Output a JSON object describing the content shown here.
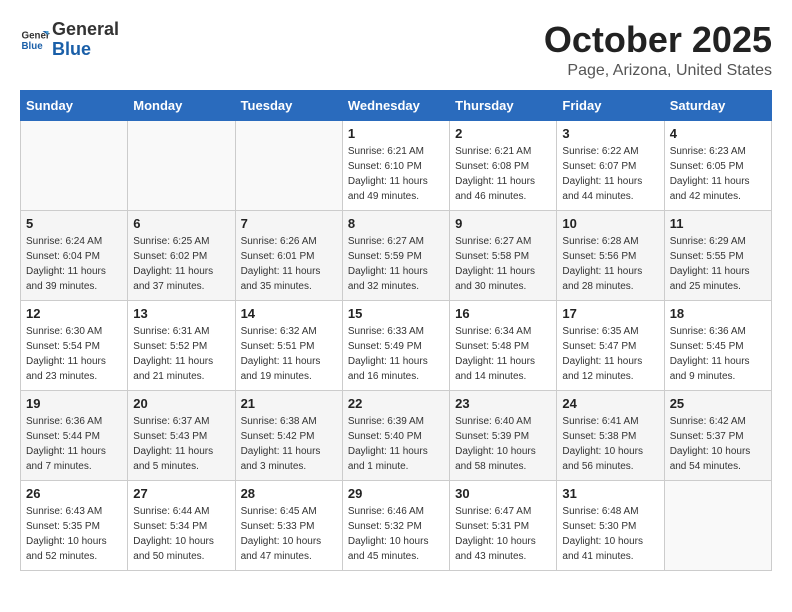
{
  "header": {
    "logo_line1": "General",
    "logo_line2": "Blue",
    "month": "October 2025",
    "location": "Page, Arizona, United States"
  },
  "days_of_week": [
    "Sunday",
    "Monday",
    "Tuesday",
    "Wednesday",
    "Thursday",
    "Friday",
    "Saturday"
  ],
  "weeks": [
    [
      {
        "day": "",
        "content": ""
      },
      {
        "day": "",
        "content": ""
      },
      {
        "day": "",
        "content": ""
      },
      {
        "day": "1",
        "content": "Sunrise: 6:21 AM\nSunset: 6:10 PM\nDaylight: 11 hours\nand 49 minutes."
      },
      {
        "day": "2",
        "content": "Sunrise: 6:21 AM\nSunset: 6:08 PM\nDaylight: 11 hours\nand 46 minutes."
      },
      {
        "day": "3",
        "content": "Sunrise: 6:22 AM\nSunset: 6:07 PM\nDaylight: 11 hours\nand 44 minutes."
      },
      {
        "day": "4",
        "content": "Sunrise: 6:23 AM\nSunset: 6:05 PM\nDaylight: 11 hours\nand 42 minutes."
      }
    ],
    [
      {
        "day": "5",
        "content": "Sunrise: 6:24 AM\nSunset: 6:04 PM\nDaylight: 11 hours\nand 39 minutes."
      },
      {
        "day": "6",
        "content": "Sunrise: 6:25 AM\nSunset: 6:02 PM\nDaylight: 11 hours\nand 37 minutes."
      },
      {
        "day": "7",
        "content": "Sunrise: 6:26 AM\nSunset: 6:01 PM\nDaylight: 11 hours\nand 35 minutes."
      },
      {
        "day": "8",
        "content": "Sunrise: 6:27 AM\nSunset: 5:59 PM\nDaylight: 11 hours\nand 32 minutes."
      },
      {
        "day": "9",
        "content": "Sunrise: 6:27 AM\nSunset: 5:58 PM\nDaylight: 11 hours\nand 30 minutes."
      },
      {
        "day": "10",
        "content": "Sunrise: 6:28 AM\nSunset: 5:56 PM\nDaylight: 11 hours\nand 28 minutes."
      },
      {
        "day": "11",
        "content": "Sunrise: 6:29 AM\nSunset: 5:55 PM\nDaylight: 11 hours\nand 25 minutes."
      }
    ],
    [
      {
        "day": "12",
        "content": "Sunrise: 6:30 AM\nSunset: 5:54 PM\nDaylight: 11 hours\nand 23 minutes."
      },
      {
        "day": "13",
        "content": "Sunrise: 6:31 AM\nSunset: 5:52 PM\nDaylight: 11 hours\nand 21 minutes."
      },
      {
        "day": "14",
        "content": "Sunrise: 6:32 AM\nSunset: 5:51 PM\nDaylight: 11 hours\nand 19 minutes."
      },
      {
        "day": "15",
        "content": "Sunrise: 6:33 AM\nSunset: 5:49 PM\nDaylight: 11 hours\nand 16 minutes."
      },
      {
        "day": "16",
        "content": "Sunrise: 6:34 AM\nSunset: 5:48 PM\nDaylight: 11 hours\nand 14 minutes."
      },
      {
        "day": "17",
        "content": "Sunrise: 6:35 AM\nSunset: 5:47 PM\nDaylight: 11 hours\nand 12 minutes."
      },
      {
        "day": "18",
        "content": "Sunrise: 6:36 AM\nSunset: 5:45 PM\nDaylight: 11 hours\nand 9 minutes."
      }
    ],
    [
      {
        "day": "19",
        "content": "Sunrise: 6:36 AM\nSunset: 5:44 PM\nDaylight: 11 hours\nand 7 minutes."
      },
      {
        "day": "20",
        "content": "Sunrise: 6:37 AM\nSunset: 5:43 PM\nDaylight: 11 hours\nand 5 minutes."
      },
      {
        "day": "21",
        "content": "Sunrise: 6:38 AM\nSunset: 5:42 PM\nDaylight: 11 hours\nand 3 minutes."
      },
      {
        "day": "22",
        "content": "Sunrise: 6:39 AM\nSunset: 5:40 PM\nDaylight: 11 hours\nand 1 minute."
      },
      {
        "day": "23",
        "content": "Sunrise: 6:40 AM\nSunset: 5:39 PM\nDaylight: 10 hours\nand 58 minutes."
      },
      {
        "day": "24",
        "content": "Sunrise: 6:41 AM\nSunset: 5:38 PM\nDaylight: 10 hours\nand 56 minutes."
      },
      {
        "day": "25",
        "content": "Sunrise: 6:42 AM\nSunset: 5:37 PM\nDaylight: 10 hours\nand 54 minutes."
      }
    ],
    [
      {
        "day": "26",
        "content": "Sunrise: 6:43 AM\nSunset: 5:35 PM\nDaylight: 10 hours\nand 52 minutes."
      },
      {
        "day": "27",
        "content": "Sunrise: 6:44 AM\nSunset: 5:34 PM\nDaylight: 10 hours\nand 50 minutes."
      },
      {
        "day": "28",
        "content": "Sunrise: 6:45 AM\nSunset: 5:33 PM\nDaylight: 10 hours\nand 47 minutes."
      },
      {
        "day": "29",
        "content": "Sunrise: 6:46 AM\nSunset: 5:32 PM\nDaylight: 10 hours\nand 45 minutes."
      },
      {
        "day": "30",
        "content": "Sunrise: 6:47 AM\nSunset: 5:31 PM\nDaylight: 10 hours\nand 43 minutes."
      },
      {
        "day": "31",
        "content": "Sunrise: 6:48 AM\nSunset: 5:30 PM\nDaylight: 10 hours\nand 41 minutes."
      },
      {
        "day": "",
        "content": ""
      }
    ]
  ]
}
